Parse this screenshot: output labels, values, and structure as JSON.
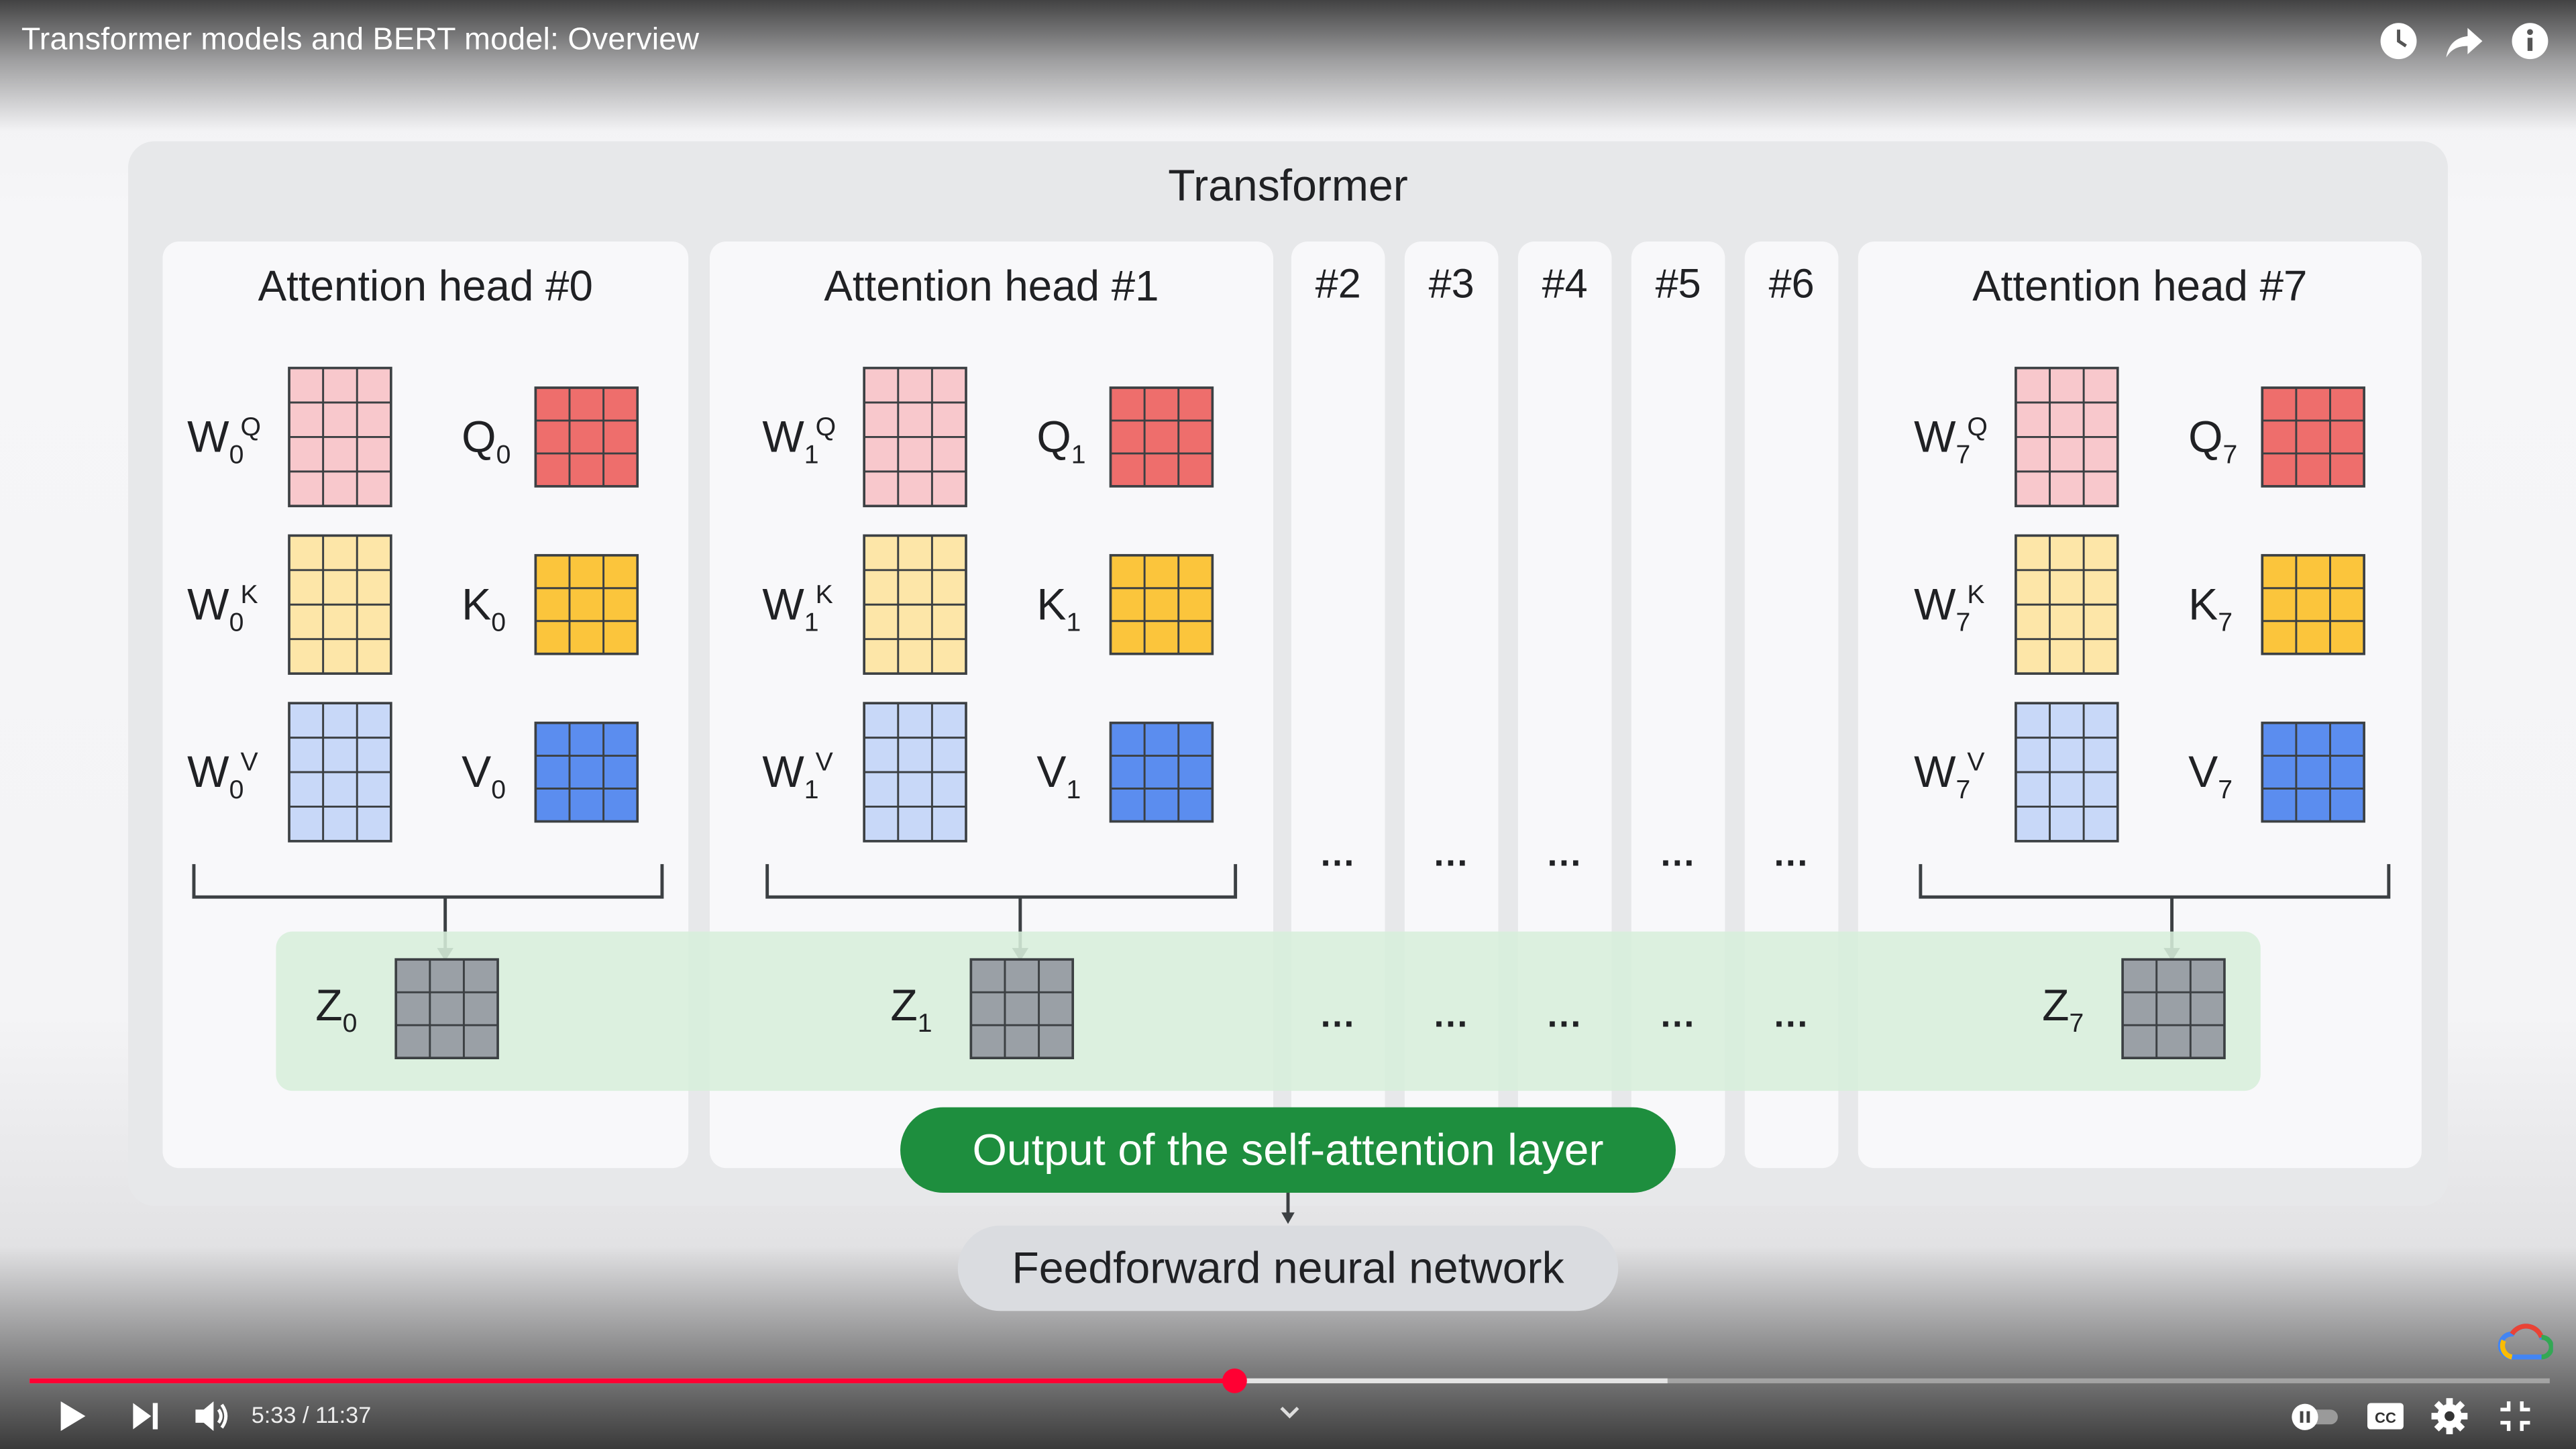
{
  "player": {
    "video_title": "Transformer models and BERT model: Overview",
    "top_icons": [
      "watch-later-icon",
      "share-icon",
      "info-icon"
    ],
    "time": "5:33 / 11:37",
    "progress": 0.478,
    "buffered": 0.65,
    "progress_color": "#ff0033"
  },
  "slide": {
    "title": "Transformer",
    "heads": [
      {
        "title": "Attention head #0",
        "wq": "W",
        "q": "Q",
        "wk": "W",
        "k": "K",
        "wv": "W",
        "v": "V",
        "index": "0",
        "z": "Z"
      },
      {
        "title": "Attention head #1",
        "wq": "W",
        "q": "Q",
        "wk": "W",
        "k": "K",
        "wv": "W",
        "v": "V",
        "index": "1",
        "z": "Z"
      },
      {
        "title": "Attention head #7",
        "wq": "W",
        "q": "Q",
        "wk": "W",
        "k": "K",
        "wv": "W",
        "v": "V",
        "index": "7",
        "z": "Z"
      }
    ],
    "superscripts": {
      "q": "Q",
      "k": "K",
      "v": "V"
    },
    "narrow_heads": [
      "#2",
      "#3",
      "#4",
      "#5",
      "#6"
    ],
    "ellipsis": "...",
    "output_label": "Output of the self-attention layer",
    "ffn_label": "Feedforward neural network",
    "colors": {
      "wq": "#f8c8cc",
      "q": "#ee6e6c",
      "wk": "#fde6a8",
      "k": "#fbc53c",
      "wv": "#c8d8f8",
      "v": "#5b8def",
      "z": "#9aa0a6",
      "output": "#1e8e3e",
      "band": "#d7eedb"
    }
  }
}
